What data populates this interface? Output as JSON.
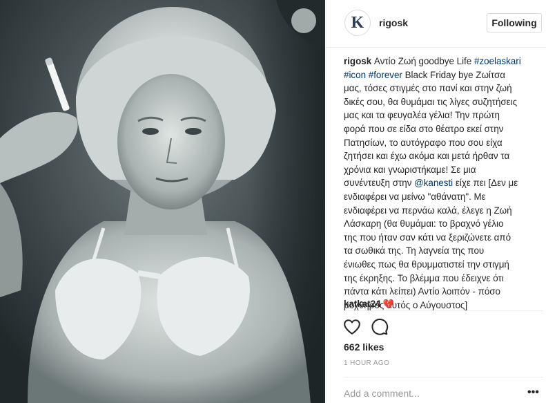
{
  "photo": {
    "description_icon": "photo-of-woman"
  },
  "header": {
    "avatar_letter": "K",
    "username": "rigosk",
    "follow_label": "Following"
  },
  "caption": {
    "author": "rigosk",
    "lines": [
      [
        {
          "t": "Αντίο Ζωή goodbye Life ",
          "k": "text"
        },
        {
          "t": "#zoelaskari",
          "k": "link"
        }
      ],
      [
        {
          "t": "#icon",
          "k": "link"
        },
        {
          "t": " ",
          "k": "text"
        },
        {
          "t": "#forever",
          "k": "link"
        },
        {
          "t": " Black Friday bye Ζωίτσα",
          "k": "text"
        }
      ],
      [
        {
          "t": "μας, τόσες στιγμές στο πανί και στην ζωή",
          "k": "text"
        }
      ],
      [
        {
          "t": "δικές σου, θα θυμάμαι τις λίγες συζητήσεις",
          "k": "text"
        }
      ],
      [
        {
          "t": "μας και τα φευγαλέα γέλια! Την πρώτη",
          "k": "text"
        }
      ],
      [
        {
          "t": "φορά που σε είδα στο θέατρο εκεί στην",
          "k": "text"
        }
      ],
      [
        {
          "t": "Πατησίων, το αυτόγραφο που σου είχα",
          "k": "text"
        }
      ],
      [
        {
          "t": "ζητήσει και έχω ακόμα και μετά ήρθαν τα",
          "k": "text"
        }
      ],
      [
        {
          "t": "χρόνια και γνωριστήκαμε! Σε μια",
          "k": "text"
        }
      ],
      [
        {
          "t": "συνέντευξη στην ",
          "k": "text"
        },
        {
          "t": "@kanesti",
          "k": "link"
        },
        {
          "t": " είχε πει [Δεν με",
          "k": "text"
        }
      ],
      [
        {
          "t": "ενδιαφέρει να μείνω \"αθάνατη\". Με",
          "k": "text"
        }
      ],
      [
        {
          "t": "ενδιαφέρει να περνάω καλά, έλεγε η Ζωή",
          "k": "text"
        }
      ],
      [
        {
          "t": "Λάσκαρη (θα θυμάμαι: το βραχνό γέλιο",
          "k": "text"
        }
      ],
      [
        {
          "t": "της που ήταν σαν κάτι να ξεριζώνετε από",
          "k": "text"
        }
      ],
      [
        {
          "t": "τα σωθικά της. Τη λαγνεία της που",
          "k": "text"
        }
      ],
      [
        {
          "t": "ένιωθες πως θα θρυμματιστεί την στιγμή",
          "k": "text"
        }
      ],
      [
        {
          "t": "της έκρηξης. Το βλέμμα που έδειχνε ότι",
          "k": "text"
        }
      ],
      [
        {
          "t": "πάντα κάτι λείπει) Αντίο λοιπόν - πόσο",
          "k": "text"
        }
      ],
      [
        {
          "t": "μοχθηρός αυτός ο Αύγουστος]",
          "k": "text"
        }
      ]
    ]
  },
  "comment": {
    "username": "katkat24",
    "text": "💔"
  },
  "actions": {
    "like_icon": "heart-outline-icon",
    "comment_icon": "speech-bubble-icon"
  },
  "likes": "662 likes",
  "timestamp": "1 HOUR AGO",
  "comment_box": {
    "placeholder": "Add a comment...",
    "more_label": "•••"
  }
}
